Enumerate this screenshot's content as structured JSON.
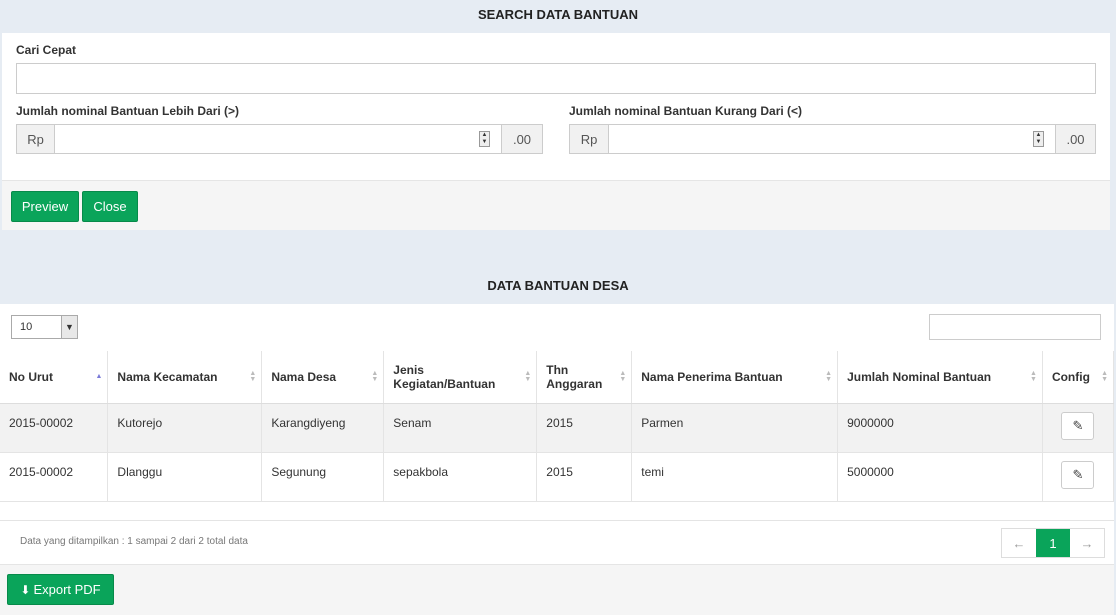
{
  "search": {
    "title": "SEARCH DATA BANTUAN",
    "quick_label": "Cari Cepat",
    "min_label": "Jumlah nominal Bantuan Lebih Dari (>)",
    "max_label": "Jumlah nominal Bantuan Kurang Dari (<)",
    "currency_prefix": "Rp",
    "decimal_suffix": ".00",
    "preview_label": "Preview",
    "close_label": "Close"
  },
  "list": {
    "title": "DATA BANTUAN DESA",
    "page_length": "10",
    "columns": [
      "No Urut",
      "Nama Kecamatan",
      "Nama Desa",
      "Jenis Kegiatan/Bantuan",
      "Thn Anggaran",
      "Nama Penerima Bantuan",
      "Jumlah Nominal Bantuan",
      "Config"
    ],
    "rows": [
      [
        "2015-00002",
        "Kutorejo",
        "Karangdiyeng",
        "Senam",
        "2015",
        "Parmen",
        "9000000"
      ],
      [
        "2015-00002",
        "Dlanggu",
        "Segunung",
        "sepakbola",
        "2015",
        "temi",
        "5000000"
      ]
    ],
    "info": "Data yang ditampilkan : 1 sampai 2 dari 2 total data",
    "pager": {
      "prev": "←",
      "current": "1",
      "next": "→"
    },
    "export_label": "Export PDF"
  }
}
